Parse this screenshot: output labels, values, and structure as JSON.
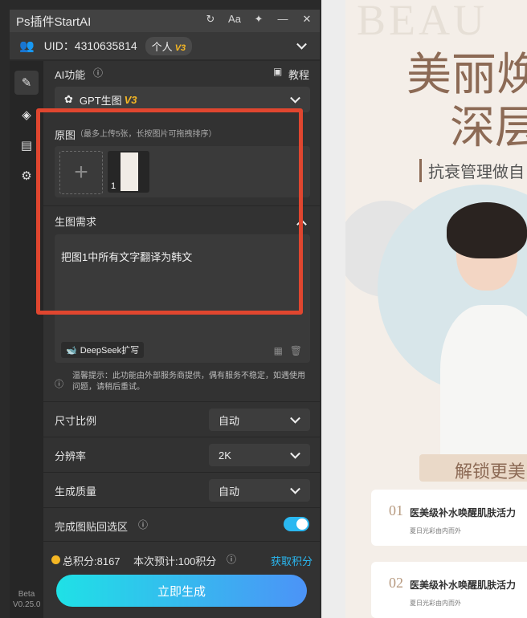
{
  "window": {
    "title": "Ps插件StartAI"
  },
  "titlebar_icons": [
    "refresh-icon",
    "font-size-icon",
    "pin-icon",
    "minimize-icon",
    "close-icon"
  ],
  "titlebar_labels": {
    "font": "Aa"
  },
  "account": {
    "uid": "UID：4310635814",
    "plan": "个人",
    "version_badge": "V3"
  },
  "sidebar": {
    "version_line1": "Beta",
    "version_line2": "V0.25.0"
  },
  "ai": {
    "label": "AI功能",
    "tutorial": "教程",
    "selected": "GPT生图",
    "badge": "V3"
  },
  "source": {
    "label": "原图",
    "hint": "（最多上传5张，长按图片可拖拽排序）",
    "thumb_index": "1"
  },
  "prompt": {
    "label": "生图需求",
    "text": "把图1中所有文字翻译为韩文",
    "deepseek": "DeepSeek扩写"
  },
  "notice": "温馨提示：此功能由外部服务商提供，偶有服务不稳定，如遇使用问题，请稍后重试。",
  "settings": {
    "aspect_label": "尺寸比例",
    "aspect_value": "自动",
    "resolution_label": "分辨率",
    "resolution_value": "2K",
    "quality_label": "生成质量",
    "quality_value": "自动",
    "paste_label": "完成图贴回选区",
    "paste_on": true
  },
  "points": {
    "total": "总积分:8167",
    "estimate": "本次预计:100积分",
    "get": "获取积分"
  },
  "generate": "立即生成",
  "preview": {
    "watermark": "BEAU",
    "title1": "美丽焕",
    "title2": "深层",
    "subtitle": "抗衰管理做自",
    "banner": "解锁更美",
    "item1_num": "01",
    "item1_title": "医美级补水唤醒肌肤活力",
    "item1_sub": "夏日光彩由内而外",
    "item2_num": "02",
    "item2_title": "医美级补水唤醒肌肤活力",
    "item2_sub": "夏日光彩由内而外"
  },
  "colors": {
    "accent": "#2ab8f1",
    "highlight": "#e0462f",
    "badge": "#f5b724"
  }
}
